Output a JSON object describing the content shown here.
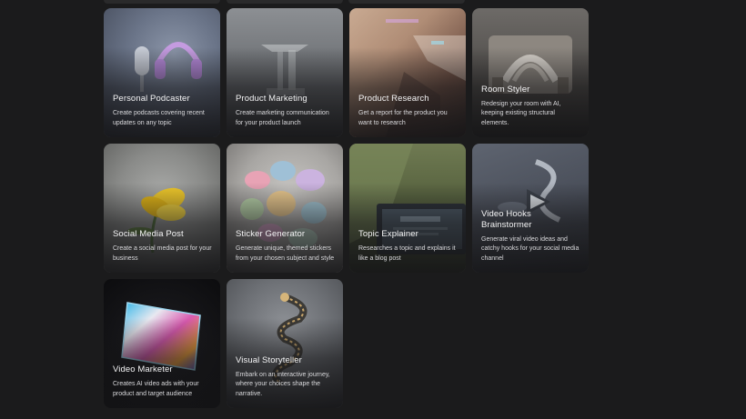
{
  "cards": [
    {
      "title": "Personal Podcaster",
      "description": "Create podcasts covering recent updates on any topic",
      "icon": "headphones-microphone-art"
    },
    {
      "title": "Product Marketing",
      "description": "Create marketing communication for your product launch",
      "icon": "glass-sculpture-art"
    },
    {
      "title": "Product Research",
      "description": "Get a report for the product you want to research",
      "icon": "light-prism-art"
    },
    {
      "title": "Room Styler",
      "description": "Redesign your room with AI, keeping existing structural elements.",
      "icon": "room-arch-art"
    },
    {
      "title": "Social Media Post",
      "description": "Create a social media post for your business",
      "icon": "yellow-flower-art"
    },
    {
      "title": "Sticker Generator",
      "description": "Generate unique, themed stickers from your chosen subject and style",
      "icon": "sticker-shapes-art"
    },
    {
      "title": "Topic Explainer",
      "description": "Researches a topic and explains it like a blog post",
      "icon": "laptop-blog-art"
    },
    {
      "title": "Video Hooks Brainstormer",
      "description": "Generate viral video ideas and catchy hooks for your social media channel",
      "icon": "play-ribbon-art"
    },
    {
      "title": "Video Marketer",
      "description": "Creates AI video ads with your product and target audience",
      "icon": "holographic-screen-art"
    },
    {
      "title": "Visual Storyteller",
      "description": "Embark on an interactive journey, where your choices shape the narrative.",
      "icon": "spiral-path-art"
    }
  ]
}
